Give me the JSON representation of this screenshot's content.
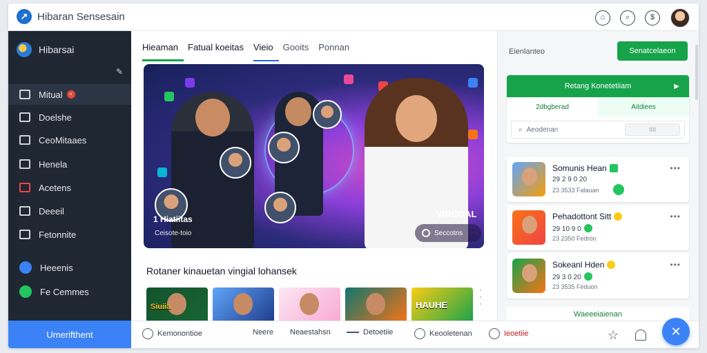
{
  "app": {
    "title": "Hibaran Sensesain"
  },
  "sidebar": {
    "header": "Hibarsai",
    "items": [
      {
        "label": "Mitual",
        "badge": "•"
      },
      {
        "label": "Doelshe"
      },
      {
        "label": "CeoMitaaes"
      },
      {
        "label": "Henela"
      },
      {
        "label": "Acetens"
      },
      {
        "label": "Deeeil"
      },
      {
        "label": "Fetonnite"
      },
      {
        "label": "Heeenis"
      },
      {
        "label": "Fe Cemmes"
      }
    ],
    "cta": "Umerifthent"
  },
  "main": {
    "tabs": [
      "Hieaman",
      "Fatual koeitas",
      "Vieio",
      "Gooits",
      "Ponnan"
    ],
    "hero": {
      "badge": "1 Hiatiitas",
      "subtitle": "Ceisote-toio",
      "label": "VIRGUAL",
      "button": "Seccotns"
    },
    "reco_title": "Rotaner kinauetan vingial lohansek",
    "thumbs": [
      {
        "label": "Siuiia"
      },
      {
        "label": ""
      },
      {
        "label": ""
      },
      {
        "label": ""
      },
      {
        "label": "HAUHE"
      }
    ]
  },
  "right": {
    "label": "Eienlanteo",
    "button": "Senatcelaeon",
    "card_title": "Retang Konetetiiam",
    "subtabs": [
      "2dbgberad",
      "Aitdiees"
    ],
    "search_placeholder": "Aeodenan",
    "search_button": "IIII",
    "contacts": [
      {
        "name": "Somunis Hean",
        "line1": "29 2 9 0 20",
        "line2": "23 3533 Falauan"
      },
      {
        "name": "Pehadottont Sitt",
        "line1": "29 10 9 0",
        "line2": "23 2350 Fedron"
      },
      {
        "name": "Sokeanl Hden",
        "line1": "29 3 0 20",
        "line2": "23 3535 Feduon"
      }
    ],
    "footer": "Waeeeiaienan"
  },
  "bottom": {
    "items": [
      "Kemonontioe",
      "Neere",
      "Neaestahsn",
      "Detoetiie",
      "Keooletenan",
      "Ieoetiie"
    ]
  }
}
